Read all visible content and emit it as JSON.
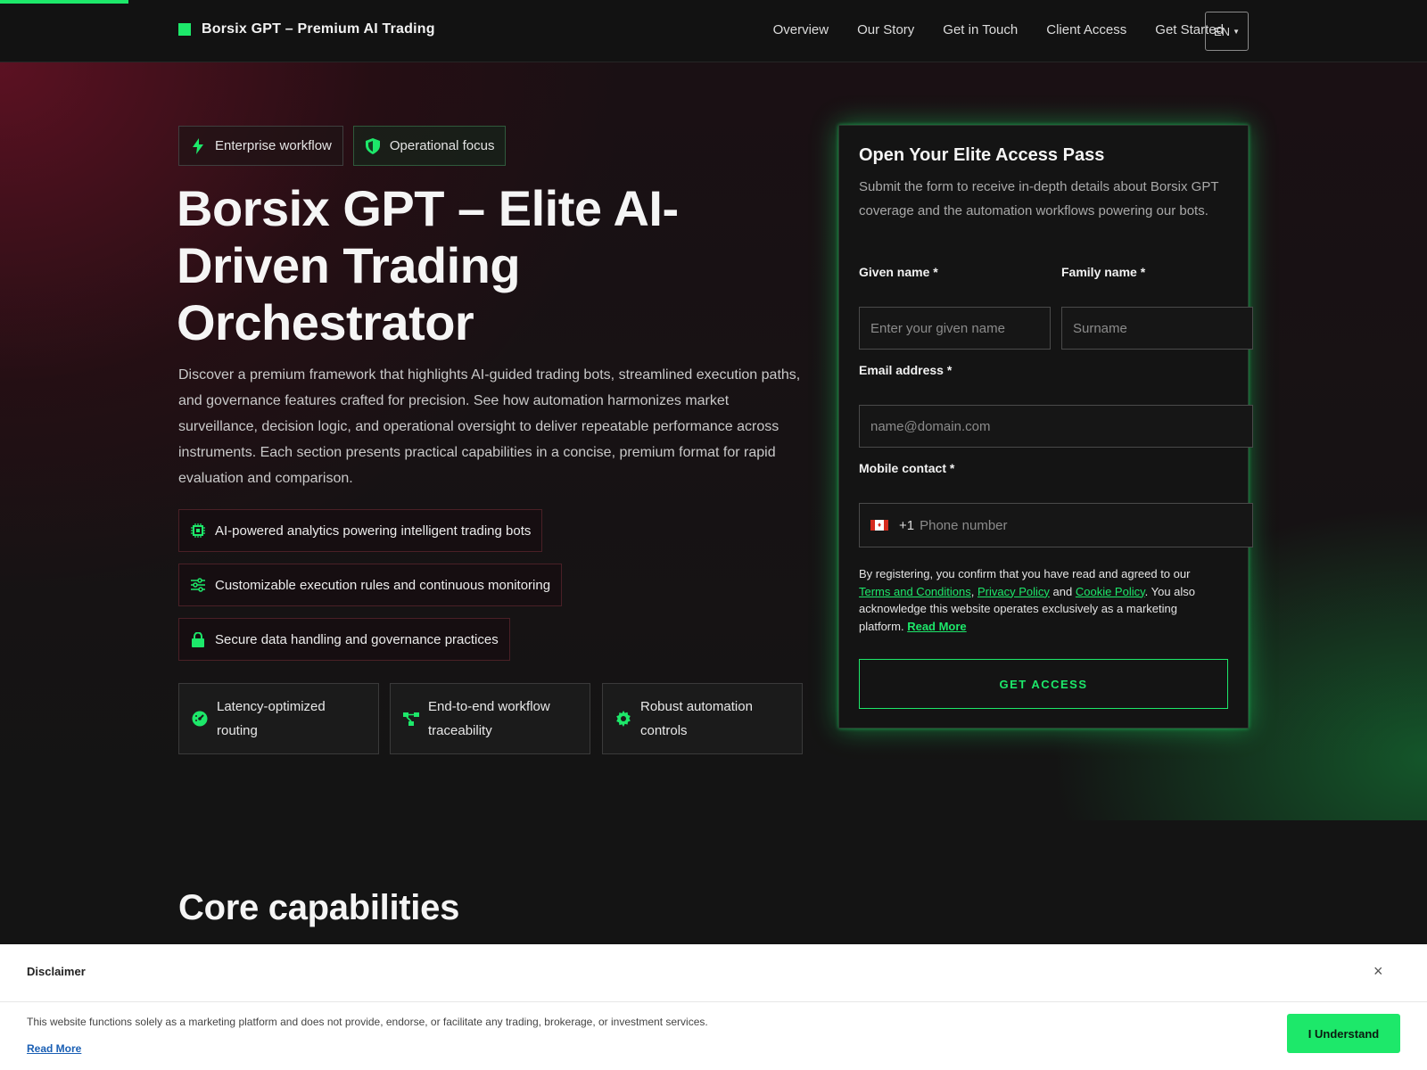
{
  "brand": {
    "name": "Borsix GPT – Premium AI Trading"
  },
  "nav": {
    "items": [
      "Overview",
      "Our Story",
      "Get in Touch",
      "Client Access",
      "Get Started"
    ],
    "language": "EN"
  },
  "hero": {
    "chips": [
      {
        "label": "Enterprise workflow",
        "icon": "lightning-icon"
      },
      {
        "label": "Operational focus",
        "icon": "shield-icon"
      }
    ],
    "title": "Borsix GPT – Elite AI-Driven Trading Orchestrator",
    "description": "Discover a premium framework that highlights AI-guided trading bots, streamlined execution paths, and governance features crafted for precision. See how automation harmonizes market surveillance, decision logic, and operational oversight to deliver repeatable performance across instruments. Each section presents practical capabilities in a concise, premium format for rapid evaluation and comparison.",
    "features": [
      {
        "label": "AI-powered analytics powering intelligent trading bots",
        "icon": "chip-icon"
      },
      {
        "label": "Customizable execution rules and continuous monitoring",
        "icon": "sliders-icon"
      },
      {
        "label": "Secure data handling and governance practices",
        "icon": "lock-icon"
      }
    ],
    "tiles": [
      {
        "label": "Latency-optimized routing",
        "icon": "gauge-icon"
      },
      {
        "label": "End-to-end workflow traceability",
        "icon": "nodes-icon"
      },
      {
        "label": "Robust automation controls",
        "icon": "gear-icon"
      }
    ]
  },
  "form": {
    "title": "Open Your Elite Access Pass",
    "subtitle": "Submit the form to receive in-depth details about Borsix GPT coverage and the automation workflows powering our bots.",
    "given_label": "Given name *",
    "given_placeholder": "Enter your given name",
    "family_label": "Family name *",
    "family_placeholder": "Surname",
    "email_label": "Email address *",
    "email_placeholder": "name@domain.com",
    "phone_label": "Mobile contact *",
    "phone_code": "+1",
    "phone_placeholder": "Phone number",
    "consent_prefix": "By registering, you confirm that you have read and agreed to our",
    "terms": "Terms and Conditions",
    "privacy": "Privacy Policy",
    "and": "and",
    "cookie": "Cookie Policy",
    "consent_suffix": ". You also acknowledge this website operates exclusively as a marketing platform.",
    "read_more": "Read More",
    "submit": "GET ACCESS"
  },
  "section": {
    "title": "Core capabilities"
  },
  "disclaimer": {
    "title": "Disclaimer",
    "close": "×",
    "text": "This website functions solely as a marketing platform and does not provide, endorse, or facilitate any trading, brokerage, or investment services.",
    "read_more": "Read More",
    "button": "I Understand"
  },
  "colors": {
    "accent": "#1de86a",
    "background": "#141414",
    "link": "#1a5fb4"
  }
}
